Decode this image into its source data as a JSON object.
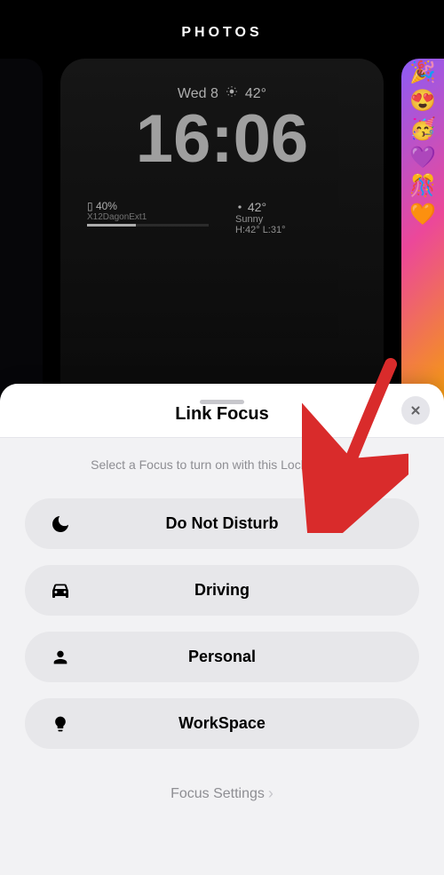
{
  "header": {
    "title": "PHOTOS"
  },
  "lockscreen": {
    "date": "Wed 8",
    "temp": "42°",
    "time": "16:06",
    "battery": {
      "percent": "40%",
      "device": "X12DagonExt1"
    },
    "weather": {
      "temp": "42°",
      "condition": "Sunny",
      "hilo": "H:42° L:31°"
    }
  },
  "sheet": {
    "title": "Link Focus",
    "subtitle": "Select a Focus to turn on with this Lock Screen.",
    "items": [
      {
        "label": "Do Not Disturb",
        "icon": "moon"
      },
      {
        "label": "Driving",
        "icon": "car"
      },
      {
        "label": "Personal",
        "icon": "person"
      },
      {
        "label": "WorkSpace",
        "icon": "lightbulb"
      }
    ],
    "settings_label": "Focus Settings"
  }
}
